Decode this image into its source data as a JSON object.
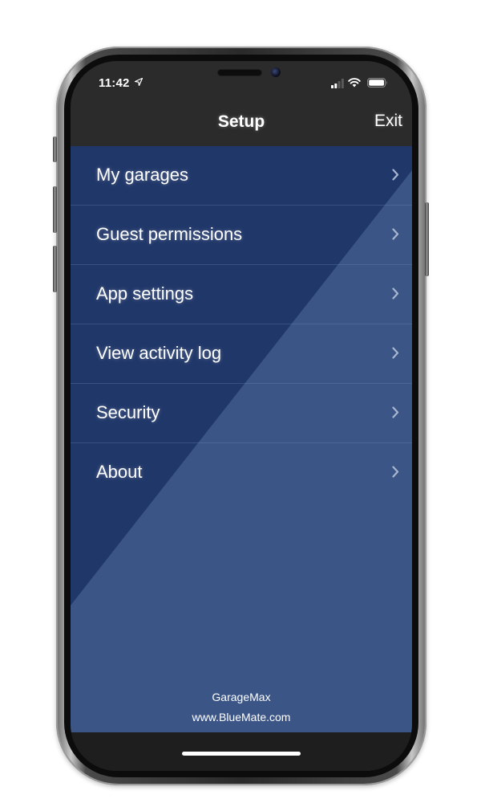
{
  "status_bar": {
    "time": "11:42"
  },
  "nav": {
    "title": "Setup",
    "exit_label": "Exit"
  },
  "menu": {
    "items": [
      {
        "label": "My garages"
      },
      {
        "label": "Guest permissions"
      },
      {
        "label": "App settings"
      },
      {
        "label": "View activity log"
      },
      {
        "label": "Security"
      },
      {
        "label": "About"
      }
    ]
  },
  "footer": {
    "app_name": "GarageMax",
    "website": "www.BlueMate.com"
  },
  "colors": {
    "menu_bg": "#22386a",
    "content_bg": "#3a5586",
    "header_bg": "#2b2b2b",
    "text": "#ffffff"
  }
}
